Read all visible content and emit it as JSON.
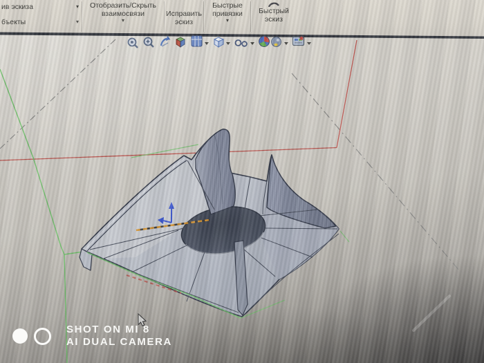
{
  "window": {
    "toolbar": {
      "left_buttons": [
        {
          "label": "ив эскиза",
          "dropdown": "▾"
        },
        {
          "label": "бъекты",
          "dropdown": "▾"
        }
      ],
      "buttons": [
        {
          "line1": "Отобразить/Скрыть",
          "line2": "взаимосвязи",
          "dropdown": "▾"
        },
        {
          "line1": "Исправить",
          "line2": "эскиз",
          "dropdown": ""
        },
        {
          "line1": "Быстрые",
          "line2": "привязки",
          "dropdown": "▾"
        },
        {
          "line1": "Быстрый",
          "line2": "эскиз",
          "dropdown": ""
        }
      ]
    },
    "view_toolbar": {
      "icons": [
        "zoom-to-fit",
        "zoom-to-area",
        "previous-view",
        "section-view",
        "view-orientation",
        "display-style",
        "hide-show-items",
        "edit-appearance",
        "apply-scene",
        "view-settings"
      ]
    }
  },
  "viewport": {
    "content": "shaded wireframe 3D part: four-point star base with central hole and curved fins",
    "sketch_colors": {
      "red": "#b8524c",
      "green": "#6fbf6a",
      "construction_grey": "#8b8b89",
      "highlight_orange": "#d09030",
      "origin_blue": "#3a55cc"
    }
  },
  "watermark": {
    "line1": "SHOT ON MI 8",
    "line2": "AI DUAL CAMERA"
  }
}
